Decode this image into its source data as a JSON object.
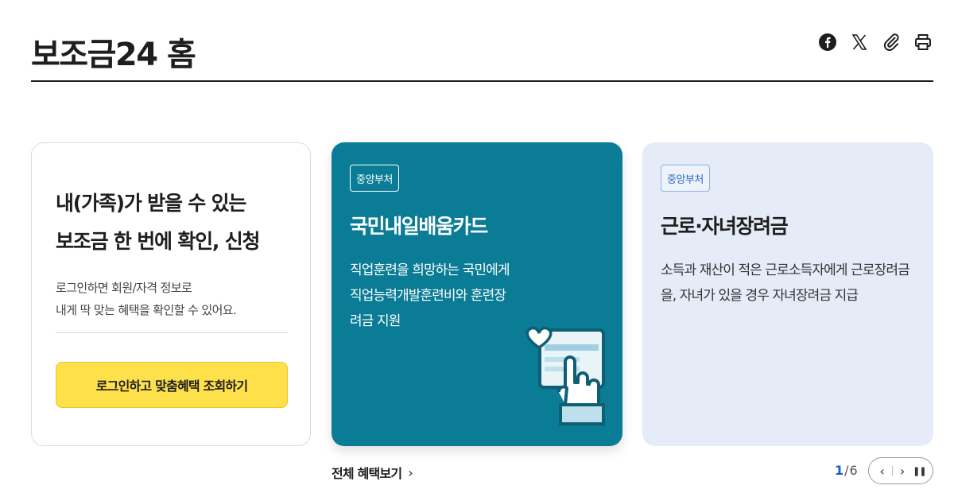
{
  "header": {
    "title": "보조금24 홈",
    "tools": [
      "facebook-icon",
      "x-icon",
      "paperclip-icon",
      "printer-icon"
    ]
  },
  "login_card": {
    "heading_line1": "내(가족)가 받을 수 있는",
    "heading_line2": "보조금 한 번에 확인, 신청",
    "desc_line1": "로그인하면 회원/자격 정보로",
    "desc_line2": "내게 딱 맞는 혜택을 확인할 수 있어요.",
    "button_label": "로그인하고 맞춤혜택 조회하기"
  },
  "cards": [
    {
      "badge": "중앙부처",
      "title": "국민내일배움카드",
      "desc": "직업훈련을 희망하는 국민에게 직업능력개발훈련비와 훈련장려금 지원",
      "bg_color": "#0a7c96"
    },
    {
      "badge": "중앙부처",
      "title": "근로·자녀장려금",
      "desc": "소득과 재산이 적은 근로소득자에게 근로장려금을, 자녀가 있을 경우 자녀장려금 지급",
      "bg_color": "#e5ebf7"
    }
  ],
  "view_all": {
    "label": "전체 혜택보기",
    "icon": "chevron-right-icon"
  },
  "pagination": {
    "current": "1",
    "separator": "/",
    "total": "6"
  },
  "controls": {
    "prev": "‹",
    "next": "›",
    "pause": "❚❚"
  },
  "colors": {
    "accent_yellow": "#fee04a",
    "pager_blue": "#1c5cc8"
  }
}
